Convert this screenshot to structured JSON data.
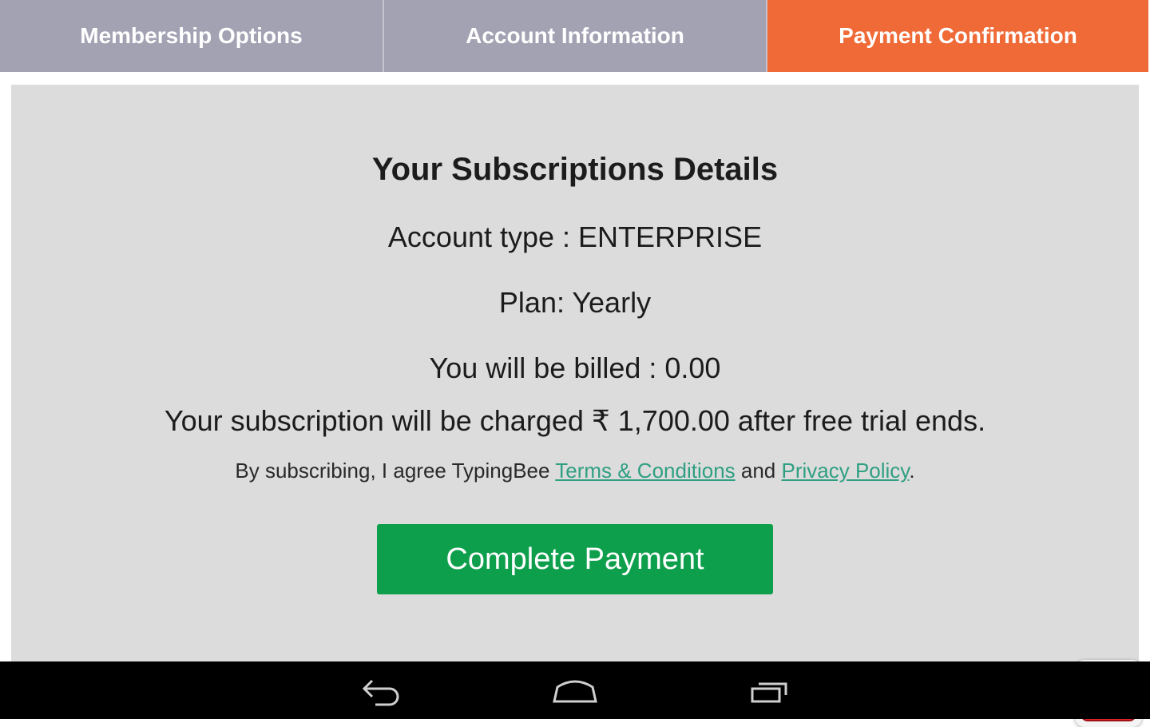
{
  "tabs": [
    {
      "label": "Membership Options",
      "active": false
    },
    {
      "label": "Account Information",
      "active": false
    },
    {
      "label": "Payment Confirmation",
      "active": true
    }
  ],
  "details": {
    "title": "Your Subscriptions Details",
    "account_type": "Account type : ENTERPRISE",
    "plan": "Plan:  Yearly",
    "billed": "You will be billed :  0.00",
    "charge_notice": "Your subscription will be charged ₹ 1,700.00 after free trial ends.",
    "agree_prefix": "By subscribing, I agree TypingBee ",
    "terms_link": "Terms & Conditions",
    "agree_and": " and ",
    "privacy_link": "Privacy Policy",
    "agree_suffix": "."
  },
  "buttons": {
    "complete_payment": "Complete Payment"
  },
  "icons": {
    "close": "close-icon",
    "back": "back-icon",
    "home": "home-icon",
    "recents": "recent-apps-icon"
  },
  "colors": {
    "tab_inactive": "#a3a2b3",
    "tab_active": "#ef6a37",
    "panel": "#dcdcdc",
    "button": "#0e9f4c",
    "link": "#2f9f82",
    "close_red": "#e0262b"
  }
}
